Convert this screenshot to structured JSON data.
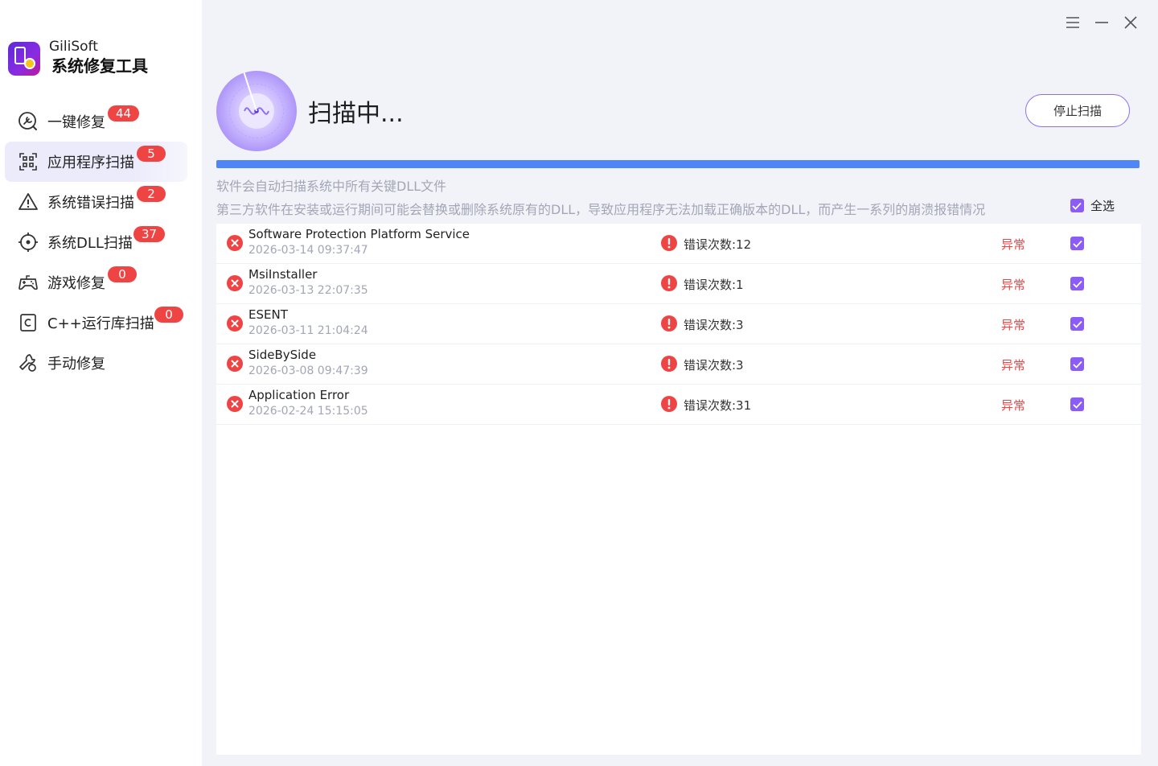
{
  "app": {
    "brand_name": "GiliSoft",
    "brand_title": "系统修复工具"
  },
  "sidebar": {
    "items": [
      {
        "label": "一键修复",
        "badge": "44",
        "icon": "wrench-search-icon"
      },
      {
        "label": "应用程序扫描",
        "badge": "5",
        "icon": "scan-icon",
        "active": true
      },
      {
        "label": "系统错误扫描",
        "badge": "2",
        "icon": "warning-icon"
      },
      {
        "label": "系统DLL扫描",
        "badge": "37",
        "icon": "target-icon"
      },
      {
        "label": "游戏修复",
        "badge": "0",
        "icon": "gamepad-icon"
      },
      {
        "label": "C++运行库扫描",
        "badge": "0",
        "icon": "cpp-icon"
      },
      {
        "label": "手动修复",
        "badge": null,
        "icon": "tools-icon"
      }
    ]
  },
  "scan": {
    "title": "扫描中...",
    "stop_label": "停止扫描",
    "progress": 1.0,
    "desc1": "软件会自动扫描系统中所有关键DLL文件",
    "desc2": "第三方软件在安装或运行期间可能会替换或删除系统原有的DLL，导致应用程序无法加载正确版本的DLL，而产生一系列的崩溃报错情况",
    "select_all_label": "全选",
    "select_all_checked": true
  },
  "results": [
    {
      "name": "Software Protection Platform Service",
      "time": "2026-03-14 09:37:47",
      "count": "错误次数:12",
      "status": "异常",
      "checked": true
    },
    {
      "name": "MsiInstaller",
      "time": "2026-03-13 22:07:35",
      "count": "错误次数:1",
      "status": "异常",
      "checked": true
    },
    {
      "name": "ESENT",
      "time": "2026-03-11 21:04:24",
      "count": "错误次数:3",
      "status": "异常",
      "checked": true
    },
    {
      "name": "SideBySide",
      "time": "2026-03-08 09:47:39",
      "count": "错误次数:3",
      "status": "异常",
      "checked": true
    },
    {
      "name": "Application Error",
      "time": "2026-02-24 15:15:05",
      "count": "错误次数:31",
      "status": "异常",
      "checked": true
    }
  ],
  "colors": {
    "accent": "#8b5cf6",
    "progress": "#4f86f7",
    "error": "#ef4444"
  }
}
